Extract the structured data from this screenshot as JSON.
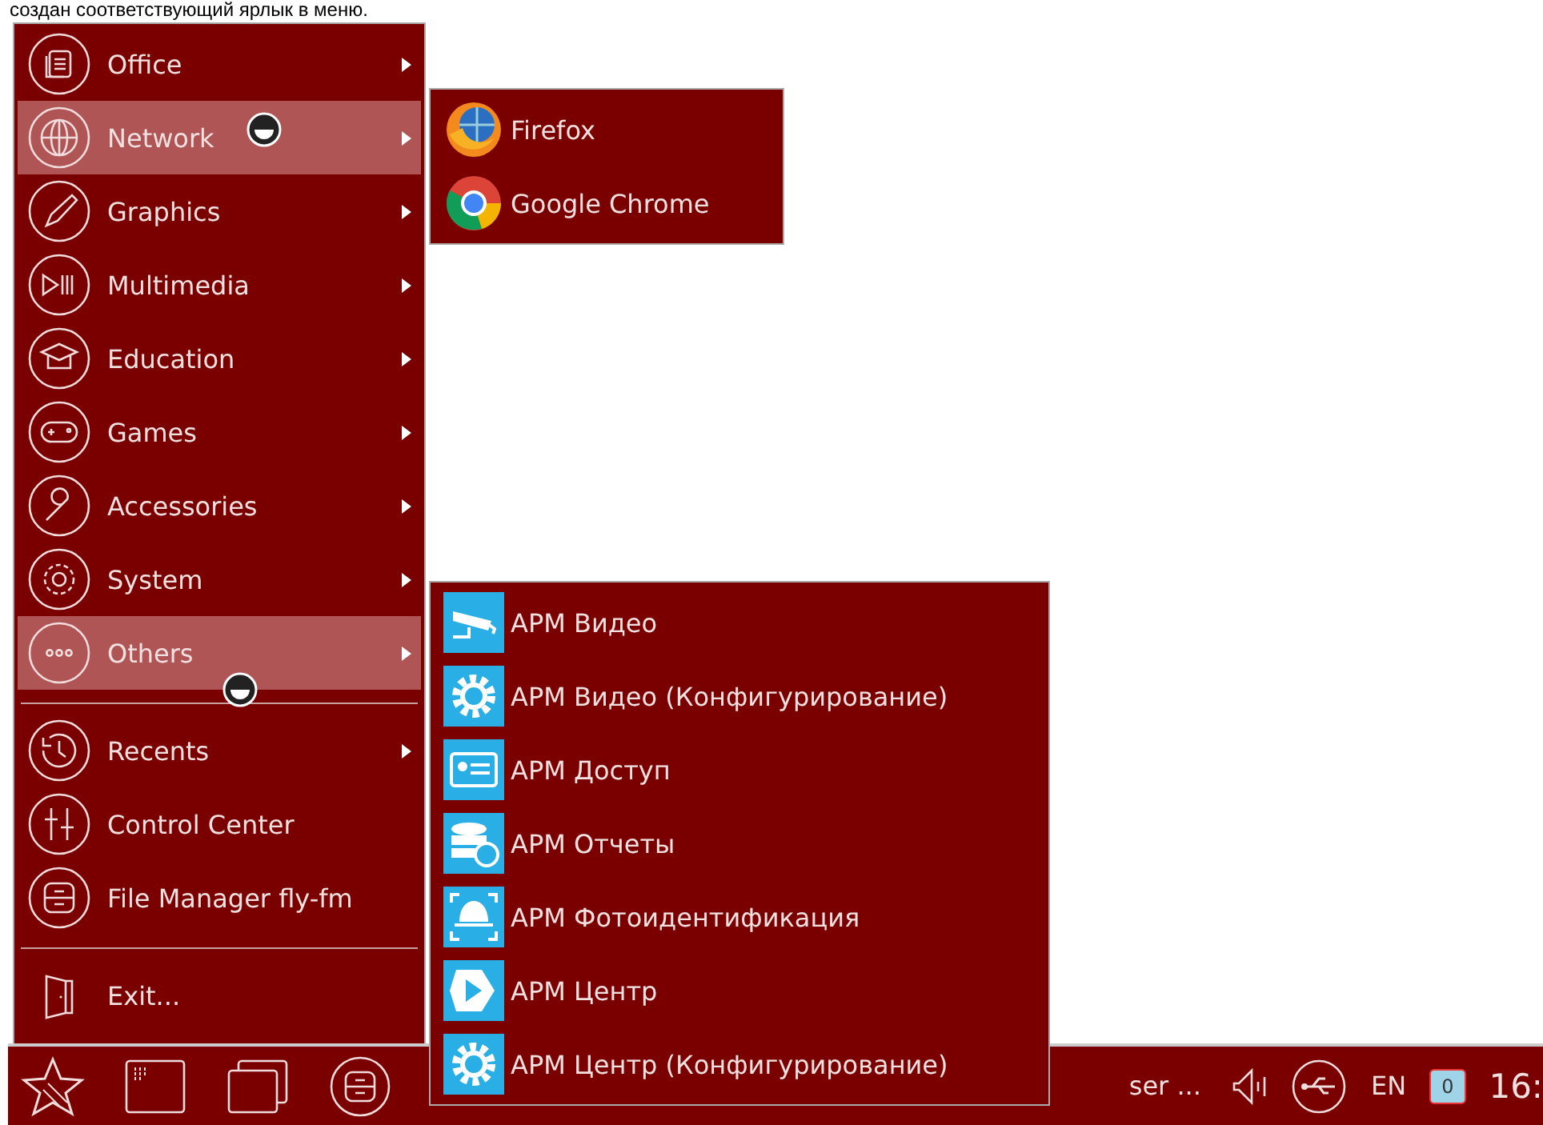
{
  "caption": "создан соответствующий ярлык в меню.",
  "menu": {
    "items": [
      {
        "kind": "category",
        "label": "Office",
        "selected": false
      },
      {
        "kind": "category",
        "label": "Network",
        "selected": true
      },
      {
        "kind": "category",
        "label": "Graphics",
        "selected": false
      },
      {
        "kind": "category",
        "label": "Multimedia",
        "selected": false
      },
      {
        "kind": "category",
        "label": "Education",
        "selected": false
      },
      {
        "kind": "category",
        "label": "Games",
        "selected": false
      },
      {
        "kind": "category",
        "label": "Accessories",
        "selected": false
      },
      {
        "kind": "category",
        "label": "System",
        "selected": false
      },
      {
        "kind": "category",
        "label": "Others",
        "selected": true
      },
      {
        "kind": "separator"
      },
      {
        "kind": "category",
        "label": "Recents",
        "selected": false
      },
      {
        "kind": "app",
        "label": "Control Center",
        "selected": false
      },
      {
        "kind": "app",
        "label": "File Manager fly-fm",
        "selected": false
      },
      {
        "kind": "separator"
      },
      {
        "kind": "exit",
        "label": "Exit...",
        "selected": false
      }
    ]
  },
  "network_submenu": {
    "items": [
      {
        "label": "Firefox"
      },
      {
        "label": "Google Chrome"
      }
    ]
  },
  "others_submenu": {
    "items": [
      {
        "label": "АРМ Видео"
      },
      {
        "label": "АРМ Видео (Конфигурирование)"
      },
      {
        "label": "АРМ Доступ"
      },
      {
        "label": "АРМ Отчеты"
      },
      {
        "label": "АРМ Фотоидентификация"
      },
      {
        "label": "АРМ Центр"
      },
      {
        "label": "АРМ Центр (Конфигурирование)"
      }
    ]
  },
  "taskbar": {
    "task_label": "ser ...",
    "language": "EN",
    "notification_count": "0",
    "clock": "16:"
  }
}
